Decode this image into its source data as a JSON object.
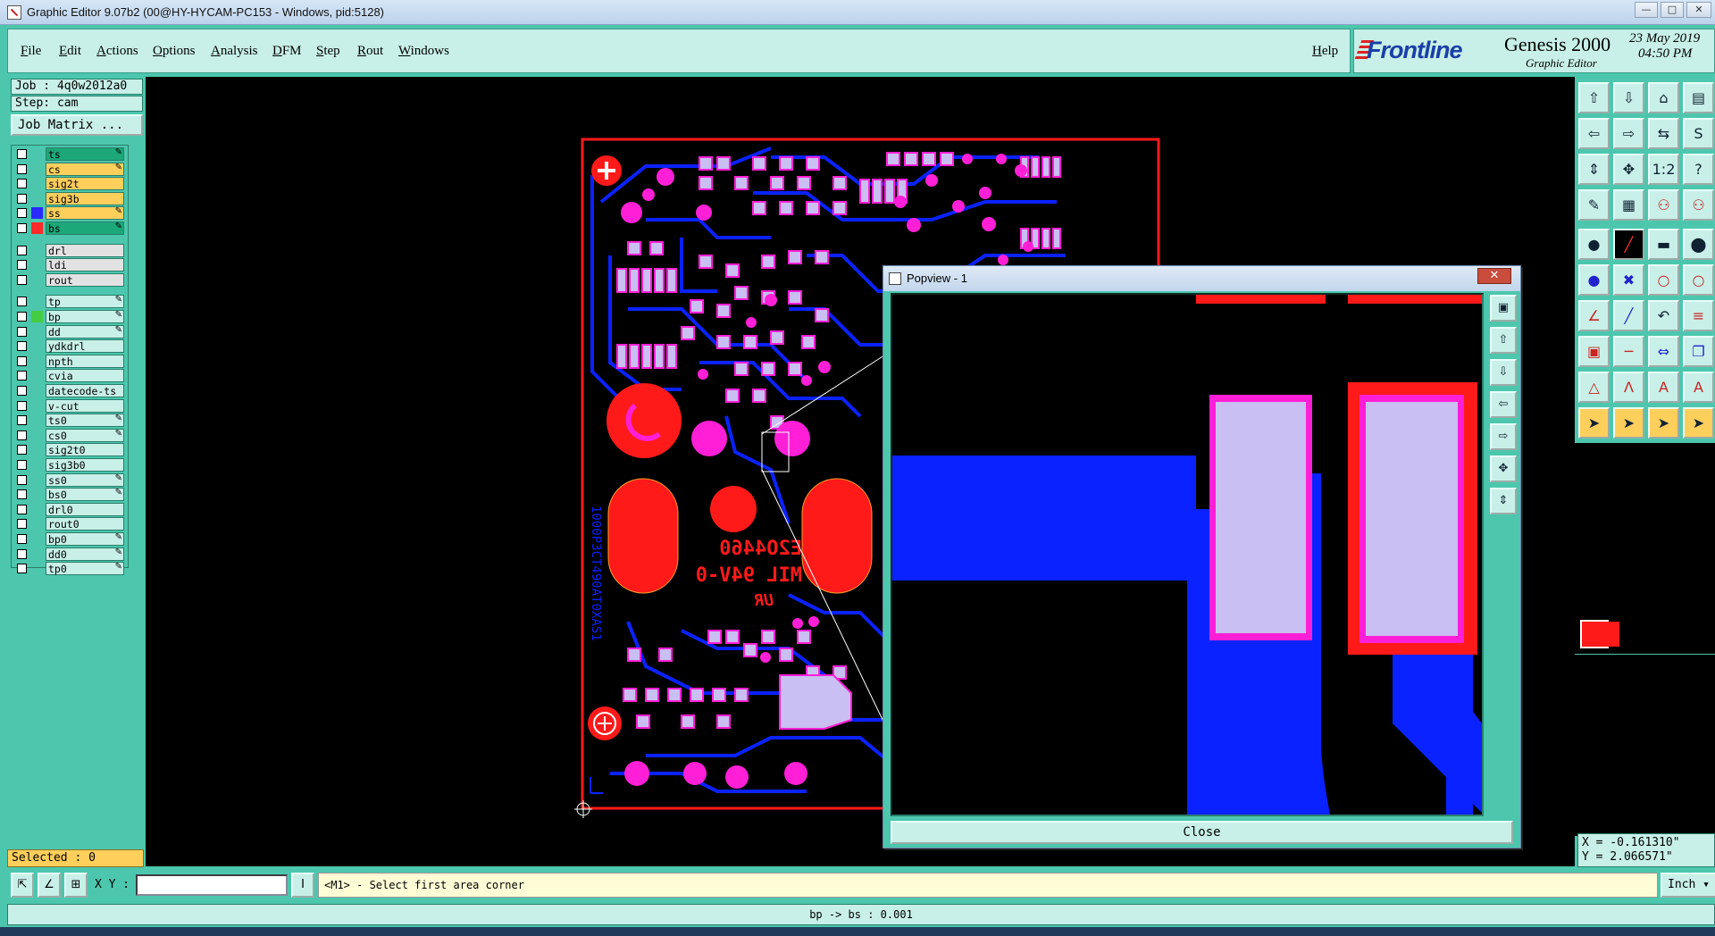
{
  "window": {
    "title": "Graphic Editor 9.07b2 (00@HY-HYCAM-PC153 - Windows, pid:5128)"
  },
  "menu": {
    "items": [
      "File",
      "Edit",
      "Actions",
      "Options",
      "Analysis",
      "DFM",
      "Step",
      "Rout",
      "Windows"
    ],
    "help": "Help"
  },
  "brand": {
    "logo": "Frontline",
    "product": "Genesis 2000",
    "subtitle": "Graphic Editor",
    "date": "23 May 2019",
    "time": "04:50 PM"
  },
  "job": {
    "job_label": "Job : 4q0w2012a0",
    "step_label": "Step: cam",
    "matrix_button": "Job Matrix ..."
  },
  "layers": [
    {
      "name": "ts",
      "color": "#ffd23a",
      "bg": "#1ca878",
      "flag": "✎"
    },
    {
      "name": "cs",
      "color": "#ffd23a",
      "bg": "#ffcf5c",
      "flag": "✎"
    },
    {
      "name": "sig2t",
      "color": "#ffd23a",
      "bg": "#ffcf5c",
      "flag": ""
    },
    {
      "name": "sig3b",
      "color": "#ffd23a",
      "bg": "#ffcf5c",
      "flag": ""
    },
    {
      "name": "ss",
      "color": "#2a2aff",
      "bg": "#ffcf5c",
      "flag": "✎"
    },
    {
      "name": "bs",
      "color": "#ff2a2a",
      "bg": "#1ca878",
      "flag": "✎"
    },
    {
      "name": "drl",
      "color": "#ddd",
      "bg": "#e2e2e2",
      "flag": ""
    },
    {
      "name": "ldi",
      "color": "#ddd",
      "bg": "#e2e2e2",
      "flag": ""
    },
    {
      "name": "rout",
      "color": "#ddd",
      "bg": "#e2e2e2",
      "flag": ""
    },
    {
      "name": "tp",
      "color": "#ddd",
      "bg": "#c8f0e8",
      "flag": "✎"
    },
    {
      "name": "bp",
      "color": "#44cc44",
      "bg": "#c8f0e8",
      "flag": "✎"
    },
    {
      "name": "dd",
      "color": "#ddd",
      "bg": "#c8f0e8",
      "flag": "✎"
    },
    {
      "name": "ydkdrl",
      "color": "#ddd",
      "bg": "#c8f0e8",
      "flag": ""
    },
    {
      "name": "npth",
      "color": "#ddd",
      "bg": "#c8f0e8",
      "flag": ""
    },
    {
      "name": "cvia",
      "color": "#ddd",
      "bg": "#c8f0e8",
      "flag": ""
    },
    {
      "name": "datecode-ts",
      "color": "#ddd",
      "bg": "#c8f0e8",
      "flag": ""
    },
    {
      "name": "v-cut",
      "color": "#ddd",
      "bg": "#c8f0e8",
      "flag": ""
    },
    {
      "name": "ts0",
      "color": "#ddd",
      "bg": "#c8f0e8",
      "flag": "✎"
    },
    {
      "name": "cs0",
      "color": "#ddd",
      "bg": "#c8f0e8",
      "flag": "✎"
    },
    {
      "name": "sig2t0",
      "color": "#ddd",
      "bg": "#c8f0e8",
      "flag": ""
    },
    {
      "name": "sig3b0",
      "color": "#ddd",
      "bg": "#c8f0e8",
      "flag": ""
    },
    {
      "name": "ss0",
      "color": "#ddd",
      "bg": "#c8f0e8",
      "flag": "✎"
    },
    {
      "name": "bs0",
      "color": "#ddd",
      "bg": "#c8f0e8",
      "flag": "✎"
    },
    {
      "name": "drl0",
      "color": "#ddd",
      "bg": "#c8f0e8",
      "flag": ""
    },
    {
      "name": "rout0",
      "color": "#ddd",
      "bg": "#c8f0e8",
      "flag": ""
    },
    {
      "name": "bp0",
      "color": "#ddd",
      "bg": "#c8f0e8",
      "flag": "✎"
    },
    {
      "name": "dd0",
      "color": "#ddd",
      "bg": "#c8f0e8",
      "flag": "✎"
    },
    {
      "name": "tp0",
      "color": "#ddd",
      "bg": "#c8f0e8",
      "flag": "✎"
    }
  ],
  "selected": "Selected : 0",
  "pcb_text": {
    "line1": "E2O4460",
    "line2": "MIL 94V-0",
    "line3": "UR",
    "side": "1000P3CT490AT0XAS1"
  },
  "popview": {
    "title": "Popview - 1",
    "close_label": "Close"
  },
  "coords": {
    "x": "X = -0.161310\"",
    "y": "Y =  2.066571\""
  },
  "command": {
    "xy_label": "X Y :",
    "xy_value": "",
    "prompt": "<M1> - Select first area corner",
    "units": "Inch"
  },
  "status": "bp -> bs : 0.001",
  "colors": {
    "panel": "#4cc7ad",
    "field": "#c8f0e8",
    "copper_blue": "#0a22ff",
    "pad_magenta": "#ff1fd6",
    "pad_fill": "#c9bff2",
    "mask_red": "#ff1a1a"
  }
}
